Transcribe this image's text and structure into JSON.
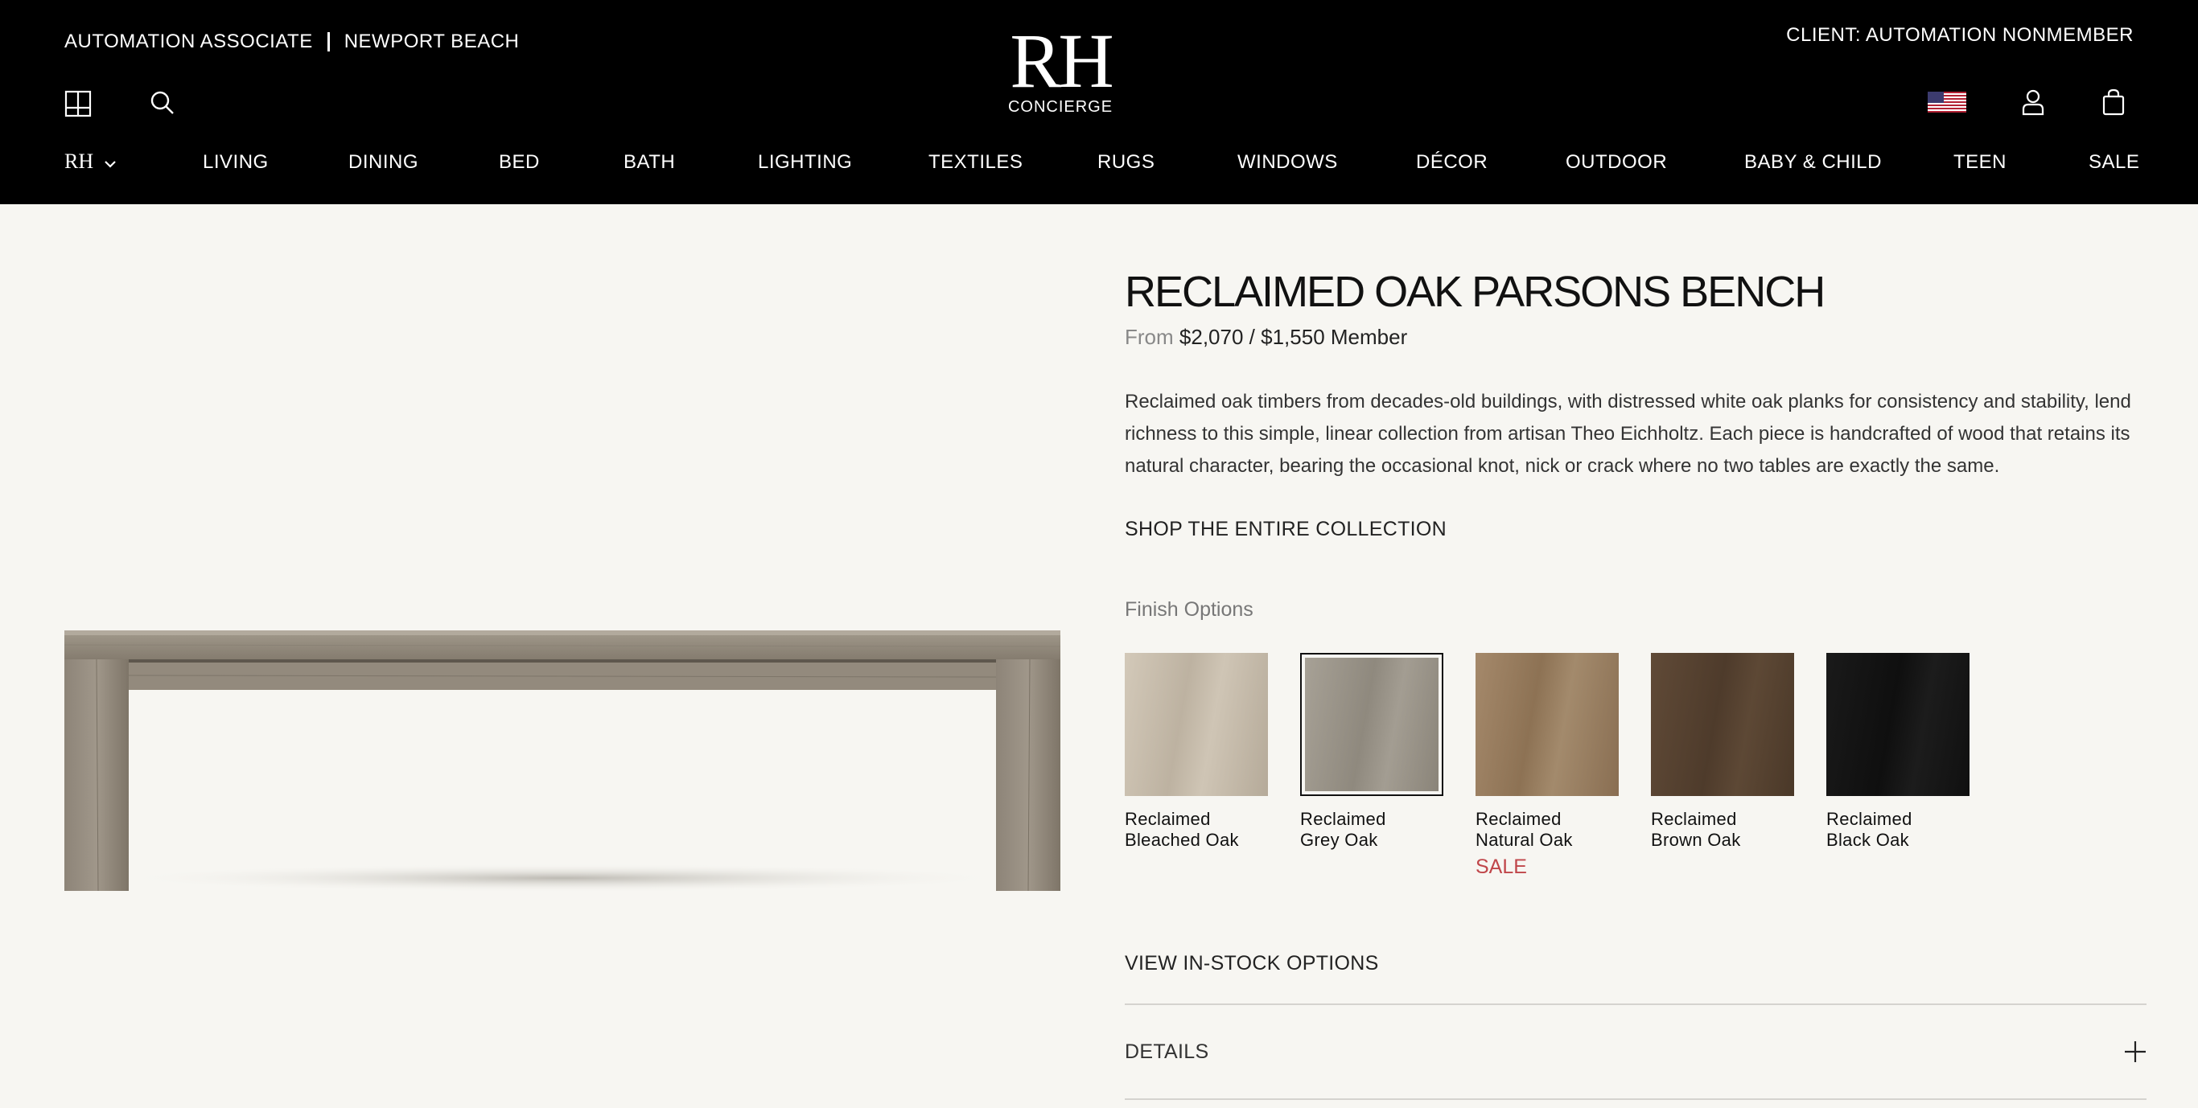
{
  "header": {
    "associate": "AUTOMATION ASSOCIATE",
    "location": "NEWPORT BEACH",
    "client": "CLIENT: AUTOMATION NONMEMBER",
    "logo_mark": "RH",
    "logo_sub": "CONCIERGE",
    "icons": [
      "gallery-icon",
      "search-icon",
      "us-flag-icon",
      "account-icon",
      "cart-icon"
    ]
  },
  "nav": {
    "brand_menu": "RH",
    "items": [
      "LIVING",
      "DINING",
      "BED",
      "BATH",
      "LIGHTING",
      "TEXTILES",
      "RUGS",
      "WINDOWS",
      "DÉCOR",
      "OUTDOOR",
      "BABY & CHILD",
      "TEEN",
      "SALE"
    ]
  },
  "product": {
    "title": "RECLAIMED OAK PARSONS BENCH",
    "price_prefix": "From",
    "price_regular": "$2,070",
    "price_sep": "/",
    "price_member": "$1,550 Member",
    "description": "Reclaimed oak timbers from decades-old buildings, with distressed white oak planks for consistency and stability, lend richness to this simple, linear collection from artisan Theo Eichholtz. Each piece is handcrafted of wood that retains its natural character, bearing the occasional knot, nick or crack where no two tables are exactly the same.",
    "collection_link": "SHOP THE ENTIRE COLLECTION",
    "finish_label": "Finish Options",
    "finishes": [
      {
        "line1": "Reclaimed",
        "line2": "Bleached Oak",
        "sale": "",
        "selected": false,
        "color": "#c9bfb0"
      },
      {
        "line1": "Reclaimed",
        "line2": "Grey Oak",
        "sale": "",
        "selected": true,
        "color": "#9c968c"
      },
      {
        "line1": "Reclaimed",
        "line2": "Natural Oak",
        "sale": "SALE",
        "selected": false,
        "color": "#9b7f61"
      },
      {
        "line1": "Reclaimed",
        "line2": "Brown Oak",
        "sale": "",
        "selected": false,
        "color": "#5a4533"
      },
      {
        "line1": "Reclaimed",
        "line2": "Black Oak",
        "sale": "",
        "selected": false,
        "color": "#151515"
      }
    ],
    "instock_link": "VIEW IN-STOCK OPTIONS",
    "details_label": "DETAILS"
  },
  "colors": {
    "header_bg": "#000000",
    "page_bg": "#f7f6f2",
    "sale": "#c0464a"
  }
}
